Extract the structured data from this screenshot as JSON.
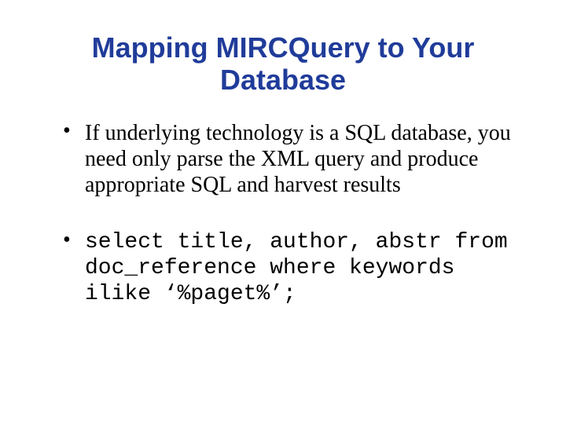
{
  "slide": {
    "title": "Mapping MIRCQuery to Your Database",
    "bullets": [
      {
        "kind": "text",
        "content": "If underlying technology is a SQL database, you need only parse the XML query and produce appropriate SQL and harvest results"
      },
      {
        "kind": "code",
        "content": "select title, author, abstr from doc_reference where keywords ilike ‘%paget%’;"
      }
    ]
  }
}
